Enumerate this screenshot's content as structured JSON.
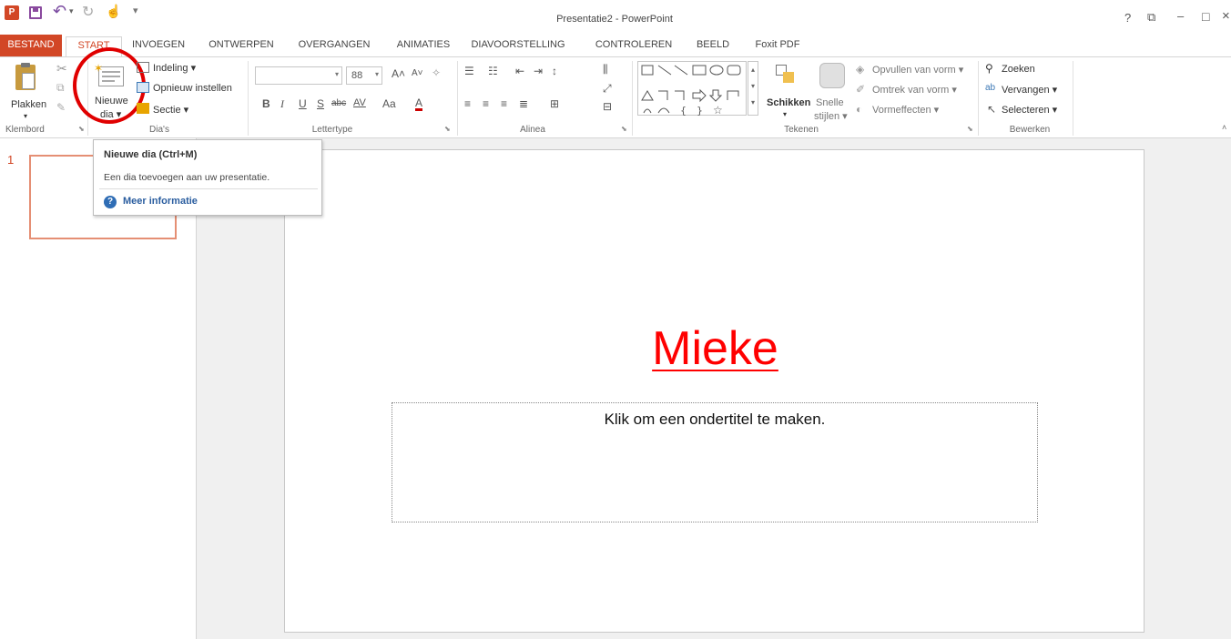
{
  "window": {
    "title": "Presentatie2 - PowerPoint",
    "controls": [
      "?",
      "⧉",
      "–",
      "□",
      "×"
    ]
  },
  "qat": {
    "app_icon": "P",
    "undo_arrow": "▾",
    "touch_arrow": "▾"
  },
  "ribbon_tabs": [
    "BESTAND",
    "START",
    "INVOEGEN",
    "ONTWERPEN",
    "OVERGANGEN",
    "ANIMATIES",
    "DIAVOORSTELLING",
    "CONTROLEREN",
    "BEELD",
    "Foxit PDF"
  ],
  "clipboard": {
    "paste_label": "Plakken",
    "group_label": "Klembord"
  },
  "slides_group": {
    "new_slide_line1": "Nieuwe",
    "new_slide_line2": "dia ▾",
    "layout": "Indeling ▾",
    "reset": "Opnieuw instellen",
    "section": "Sectie ▾",
    "group_label": "Dia's"
  },
  "font_group": {
    "font_size": "88",
    "bold": "B",
    "italic": "I",
    "underline": "U",
    "shadow": "S",
    "strike": "abc",
    "spacing": "AV",
    "case": "Aa",
    "color": "A",
    "grow": "A˄",
    "shrink": "A˅",
    "group_label": "Lettertype"
  },
  "paragraph_group": {
    "group_label": "Alinea"
  },
  "drawing_group": {
    "arrange": "Schikken",
    "quick_styles_line1": "Snelle",
    "quick_styles_line2": "stijlen ▾",
    "fill": "Opvullen van vorm ▾",
    "outline": "Omtrek van vorm ▾",
    "effects": "Vormeffecten ▾",
    "group_label": "Tekenen"
  },
  "editing_group": {
    "find": "Zoeken",
    "replace": "Vervangen ▾",
    "select": "Selecteren ▾",
    "group_label": "Bewerken"
  },
  "tooltip": {
    "title": "Nieuwe dia (Ctrl+M)",
    "description": "Een dia toevoegen aan uw presentatie.",
    "more_info": "Meer informatie"
  },
  "thumbnail": {
    "number": "1"
  },
  "slide": {
    "title": "Mieke",
    "subtitle_placeholder": "Klik om een ondertitel te maken."
  },
  "colors": {
    "accent": "#d24726",
    "title_red": "#ff0000",
    "annotation_circle": "#e00000"
  }
}
